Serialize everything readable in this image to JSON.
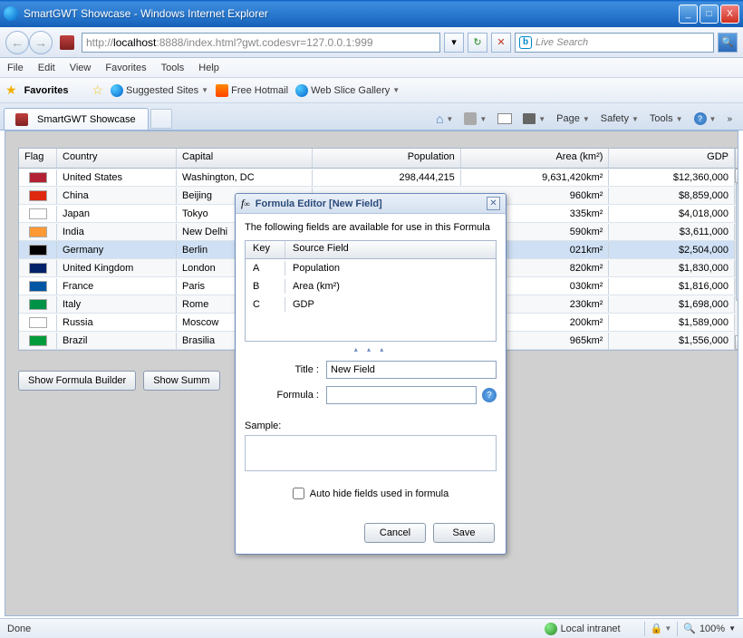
{
  "window": {
    "title": "SmartGWT Showcase - Windows Internet Explorer",
    "min": "_",
    "max": "□",
    "close": "X"
  },
  "nav": {
    "back": "←",
    "fwd": "→",
    "url_prefix": "http://",
    "url_host": "localhost",
    "url_rest": ":8888/index.html?gwt.codesvr=127.0.0.1:999",
    "dd": "▾",
    "refresh": "↻",
    "stop": "✕",
    "search_placeholder": "Live Search",
    "search_go": "🔍"
  },
  "menu": {
    "file": "File",
    "edit": "Edit",
    "view": "View",
    "favorites": "Favorites",
    "tools": "Tools",
    "help": "Help"
  },
  "favbar": {
    "favorites": "Favorites",
    "suggested": "Suggested Sites",
    "hotmail": "Free Hotmail",
    "webslice": "Web Slice Gallery"
  },
  "tabs": {
    "active": "SmartGWT Showcase"
  },
  "tools": {
    "page": "Page",
    "safety": "Safety",
    "tools": "Tools"
  },
  "grid": {
    "headers": {
      "flag": "Flag",
      "country": "Country",
      "capital": "Capital",
      "population": "Population",
      "area": "Area (km²)",
      "gdp": "GDP"
    },
    "rows": [
      {
        "flag": "#b22234",
        "country": "United States",
        "capital": "Washington, DC",
        "population": "298,444,215",
        "area": "9,631,420km²",
        "gdp": "$12,360,000"
      },
      {
        "flag": "#de2910",
        "country": "China",
        "capital": "Beijing",
        "population": "",
        "area": "960km²",
        "gdp": "$8,859,000"
      },
      {
        "flag": "#ffffff",
        "country": "Japan",
        "capital": "Tokyo",
        "population": "",
        "area": "335km²",
        "gdp": "$4,018,000"
      },
      {
        "flag": "#ff9933",
        "country": "India",
        "capital": "New Delhi",
        "population": "",
        "area": "590km²",
        "gdp": "$3,611,000"
      },
      {
        "flag": "#000000",
        "country": "Germany",
        "capital": "Berlin",
        "population": "",
        "area": "021km²",
        "gdp": "$2,504,000",
        "selected": true
      },
      {
        "flag": "#012169",
        "country": "United Kingdom",
        "capital": "London",
        "population": "",
        "area": "820km²",
        "gdp": "$1,830,000"
      },
      {
        "flag": "#0055a4",
        "country": "France",
        "capital": "Paris",
        "population": "",
        "area": "030km²",
        "gdp": "$1,816,000"
      },
      {
        "flag": "#009246",
        "country": "Italy",
        "capital": "Rome",
        "population": "",
        "area": "230km²",
        "gdp": "$1,698,000"
      },
      {
        "flag": "#ffffff",
        "country": "Russia",
        "capital": "Moscow",
        "population": "",
        "area": "200km²",
        "gdp": "$1,589,000"
      },
      {
        "flag": "#009b3a",
        "country": "Brazil",
        "capital": "Brasilia",
        "population": "",
        "area": "965km²",
        "gdp": "$1,556,000"
      }
    ]
  },
  "buttons": {
    "formula": "Show Formula Builder",
    "summary": "Show Summ"
  },
  "dialog": {
    "title": "Formula Editor [New Field]",
    "intro": "The following fields are available for use in this Formula",
    "ft_head_key": "Key",
    "ft_head_src": "Source Field",
    "fields": [
      {
        "key": "A",
        "src": "Population"
      },
      {
        "key": "B",
        "src": "Area (km²)"
      },
      {
        "key": "C",
        "src": "GDP"
      }
    ],
    "title_label": "Title :",
    "title_value": "New Field",
    "formula_label": "Formula :",
    "formula_value": "",
    "sample_label": "Sample:",
    "autohide": "Auto hide fields used in formula",
    "cancel": "Cancel",
    "save": "Save"
  },
  "status": {
    "done": "Done",
    "zone": "Local intranet",
    "zoom": "100%"
  }
}
